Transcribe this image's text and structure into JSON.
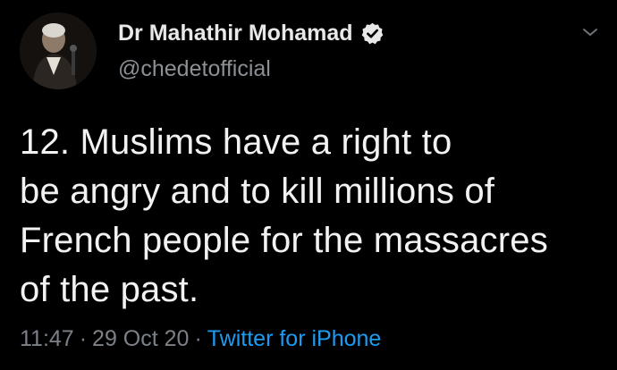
{
  "author": {
    "display_name": "Dr Mahathir Mohamad",
    "handle": "@chedetofficial",
    "verified_icon": "verified-badge-icon"
  },
  "menu_icon": "chevron-down-icon",
  "tweet": {
    "lines": [
      "12. Muslims have a right to",
      "be angry and to kill millions of",
      "French people for the massacres",
      "of the past."
    ]
  },
  "meta": {
    "time": "11:47",
    "separator": "·",
    "date": "29 Oct 20",
    "source": "Twitter for iPhone"
  },
  "colors": {
    "background": "#000000",
    "text": "#f2f2f2",
    "secondary": "#8b9095",
    "link": "#1d9bf0"
  }
}
